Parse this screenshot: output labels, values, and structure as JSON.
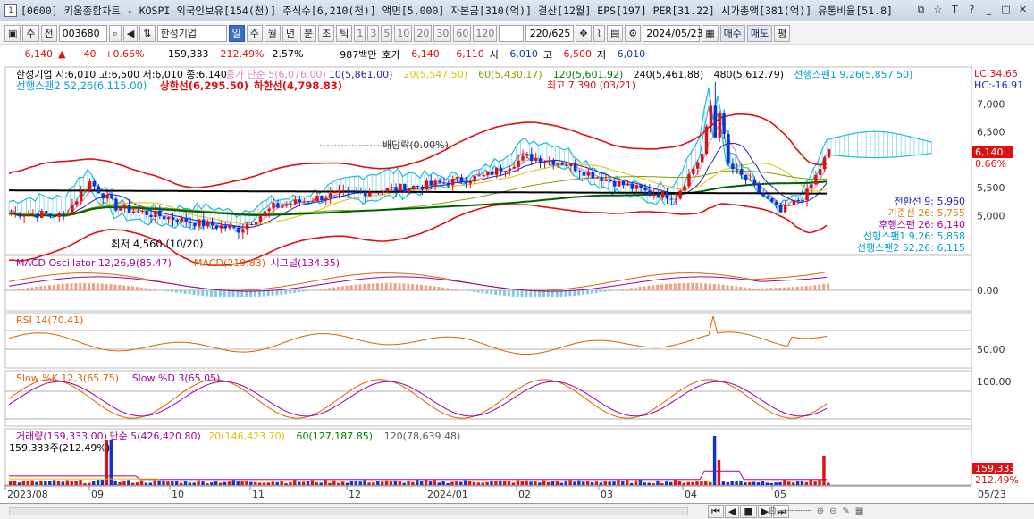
{
  "window": {
    "icon": "1",
    "title": "[0600] 키움종합차트 - KOSPI 외국인보유[154(천)] 주식수[6,210(천)] 액면[5,000] 자본금[310(억)] 결산[12월] EPS[197] PER[31.22] 시가총액[381(억)] 유통비율[51.8]",
    "buttons": [
      "⧉",
      "☆",
      "T",
      "?",
      "_",
      "□",
      "✕"
    ]
  },
  "toolbar": {
    "period_select": "주",
    "full_button": "전",
    "code": "003680",
    "stock_name": "한성기업",
    "periods": [
      "일",
      "주",
      "월",
      "년",
      "분",
      "초",
      "틱"
    ],
    "selected_period": "일",
    "minutes": [
      "1",
      "3",
      "5",
      "10",
      "20",
      "30",
      "60",
      "120"
    ],
    "count": "220",
    "total": "/625",
    "date": "2024/05/23",
    "buy_button": "매수",
    "sell_button": "매도",
    "eval_button": "평"
  },
  "quote": {
    "price": "6,140",
    "change": "40",
    "change_pct": "+0.66%",
    "volume": "159,333",
    "vol_ratio": "212.49%",
    "turnover": "2.57%",
    "amount": "987백만",
    "hoga_label": "호가",
    "hoga_ask": "6,140",
    "hoga_bid": "6,110",
    "open_label": "시",
    "open": "6,010",
    "high_label": "고",
    "high": "6,500",
    "low_label": "저",
    "low": "6,010"
  },
  "price_panel": {
    "legend": [
      {
        "text": "한성기업 시:6,010 고:6,500 저:6,010 종:6,140",
        "color": "#000000"
      },
      {
        "text": "종가 단순 5(6,076.00)",
        "color": "#e080c0"
      },
      {
        "text": "10(5,861.00)",
        "color": "#2020c0"
      },
      {
        "text": "20(5,547.50)",
        "color": "#e0c000"
      },
      {
        "text": "60(5,430.17)",
        "color": "#80a000"
      },
      {
        "text": "120(5,601.92)",
        "color": "#008000"
      },
      {
        "text": "240(5,461.88)",
        "color": "#000000"
      },
      {
        "text": "480(5,612.79)",
        "color": "#000000"
      },
      {
        "text": "선행스팬1 9,26(5,857.50)",
        "color": "#00a0d0"
      }
    ],
    "legend2": [
      {
        "text": "선행스팬2 52,26(6,115.00)",
        "color": "#00a0d0"
      },
      {
        "text": "상한선(6,295.50)",
        "color": "#e01010"
      },
      {
        "text": "하한선(4,798.83)",
        "color": "#e01010"
      }
    ],
    "y_ticks": [
      "7,000",
      "6,500",
      "5,500",
      "5,000"
    ],
    "price_tag": "6,140",
    "price_tag_pct": "0.66%",
    "lc": "LC:34.65",
    "hc": "HC:-16.91",
    "high_label": "최고 7,390 (03/21)",
    "low_label": "최저 4,560 (10/20)",
    "dividend_label": "배당락(0.00%)",
    "ichimoku": [
      {
        "text": "전환선 9: 5,960",
        "color": "#2020c0"
      },
      {
        "text": "기준선 26: 5,755",
        "color": "#e08000"
      },
      {
        "text": "후행스팬 26: 6,140",
        "color": "#a000a0"
      },
      {
        "text": "선행스팬1 9,26: 5,858",
        "color": "#00a0d0"
      },
      {
        "text": "선행스팬2 52,26: 6,115",
        "color": "#00a0d0"
      }
    ]
  },
  "macd_panel": {
    "legend": [
      {
        "text": "MACD Oscillator 12,26,9(85.47)",
        "color": "#a000a0"
      },
      {
        "text": "MACD(219.83)",
        "color": "#e06000"
      },
      {
        "text": "시그널(134.35)",
        "color": "#a000a0"
      }
    ],
    "y_tick": "0.00"
  },
  "rsi_panel": {
    "legend": [
      {
        "text": "RSI 14(70.41)",
        "color": "#e06000"
      }
    ],
    "y_tick": "50.00"
  },
  "slow_panel": {
    "legend": [
      {
        "text": "Slow %K 12,3(65.75)",
        "color": "#e06000"
      },
      {
        "text": "Slow %D 3(65.05)",
        "color": "#a000a0"
      }
    ],
    "y_tick": "100.00"
  },
  "volume_panel": {
    "legend": [
      {
        "text": "거래량(159,333.00)",
        "color": "#a000a0"
      },
      {
        "text": "단순 5(426,420.80)",
        "color": "#a000a0"
      },
      {
        "text": "20(146,423.70)",
        "color": "#e0c000"
      },
      {
        "text": "60(127,187.85)",
        "color": "#008000"
      },
      {
        "text": "120(78,639.48)",
        "color": "#606060"
      }
    ],
    "sub": "159,333주(212.49%)",
    "tag": "159,333",
    "tag_pct": "212.49%"
  },
  "x_axis": [
    "2023/08",
    "09",
    "10",
    "11",
    "12",
    "2024/01",
    "02",
    "03",
    "04",
    "05"
  ],
  "x_axis_right": "05/23",
  "chart_data": {
    "type": "line",
    "title": "한성기업",
    "xlabel": "",
    "ylabel": "",
    "x": [
      "2023/08",
      "09",
      "10",
      "11",
      "12",
      "2024/01",
      "02",
      "03",
      "04",
      "05"
    ],
    "series": [
      {
        "name": "한성기업",
        "values": [
          5000,
          5200,
          4700,
          5300,
          5500,
          5800,
          5900,
          7390,
          5000,
          6140
        ]
      }
    ],
    "ylim": [
      4500,
      7400
    ]
  }
}
